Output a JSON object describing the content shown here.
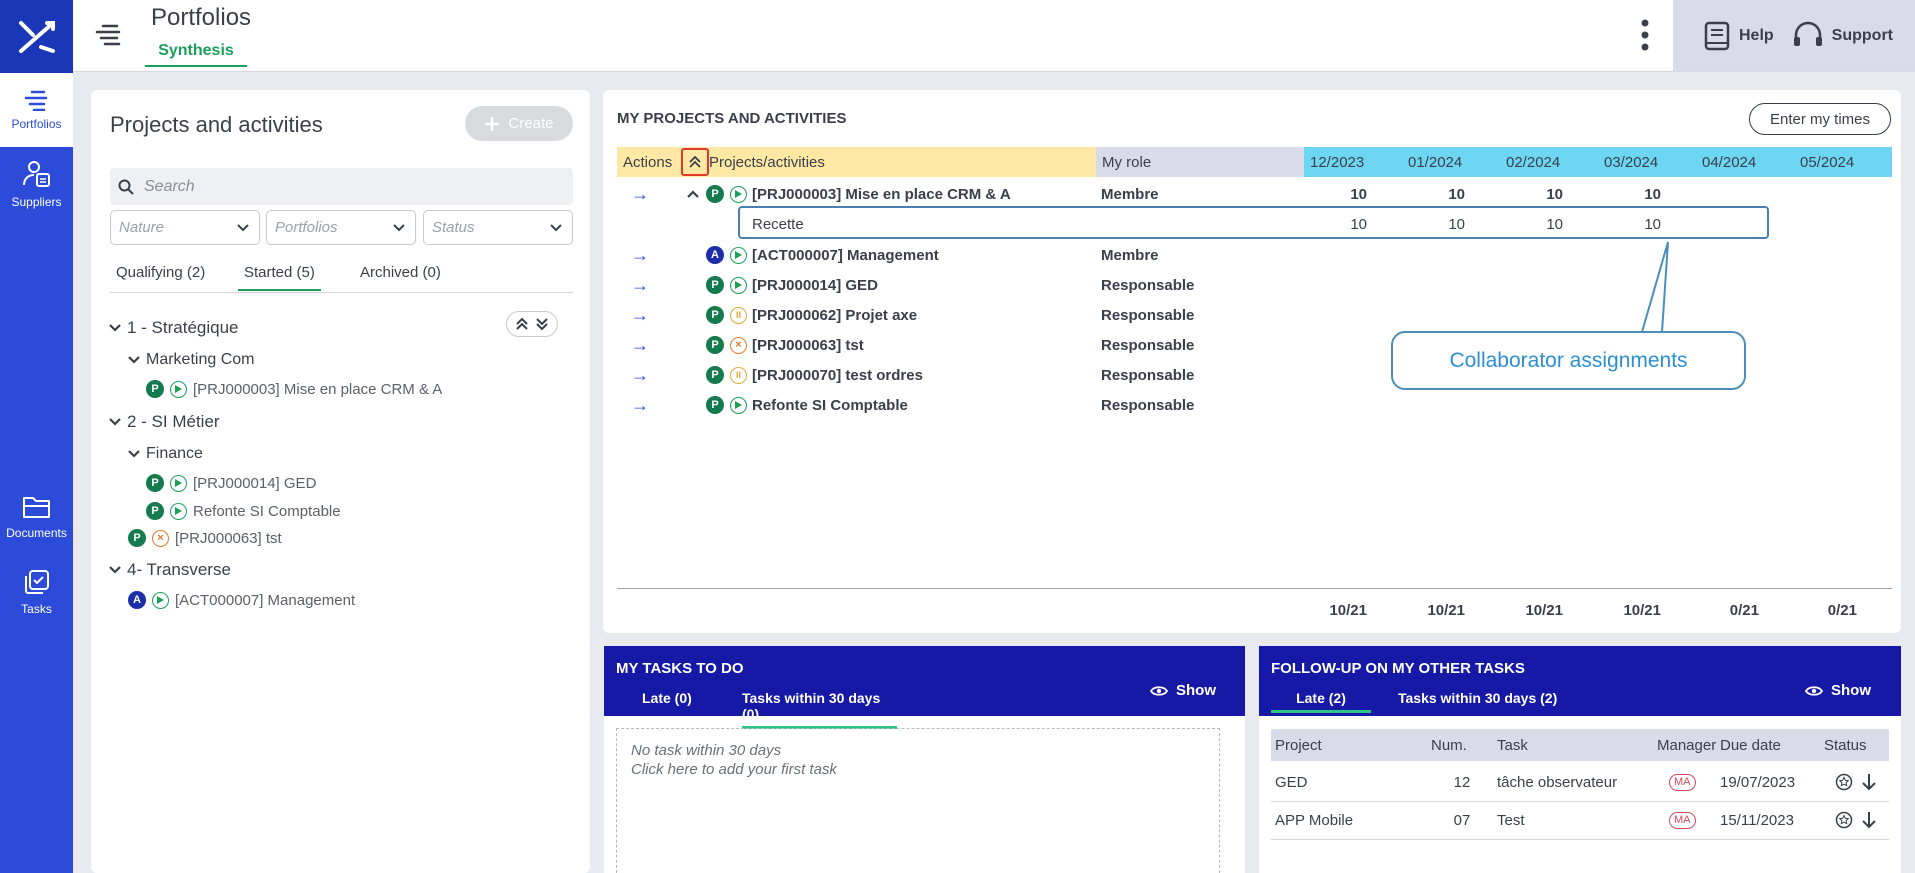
{
  "app": {
    "title": "Portfolios",
    "subtab": "Synthesis"
  },
  "sidebar": {
    "items": [
      {
        "label": "Portfolios"
      },
      {
        "label": "Suppliers"
      },
      {
        "label": "Documents"
      },
      {
        "label": "Tasks"
      }
    ]
  },
  "header": {
    "help": "Help",
    "support": "Support"
  },
  "left": {
    "title": "Projects and activities",
    "create": "Create",
    "search_placeholder": "Search",
    "filters": [
      "Nature",
      "Portfolios",
      "Status"
    ],
    "tabs": [
      "Qualifying (2)",
      "Started (5)",
      "Archived (0)"
    ],
    "tree": [
      {
        "label": "1 - Stratégique"
      },
      {
        "label": "Marketing Com"
      },
      {
        "label": "[PRJ000003] Mise en place CRM & A"
      },
      {
        "label": "2 - SI Métier"
      },
      {
        "label": "Finance"
      },
      {
        "label": "[PRJ000014] GED"
      },
      {
        "label": "Refonte SI Comptable"
      },
      {
        "label": "[PRJ000063] tst"
      },
      {
        "label": "4- Transverse"
      },
      {
        "label": "[ACT000007] Management"
      }
    ]
  },
  "main": {
    "title": "MY PROJECTS AND ACTIVITIES",
    "enter_times": "Enter my times",
    "headers": {
      "actions": "Actions",
      "projects": "Projects/activities",
      "role": "My role",
      "months": [
        "12/2023",
        "01/2024",
        "02/2024",
        "03/2024",
        "04/2024",
        "05/2024"
      ]
    },
    "rows": [
      {
        "badge": "P",
        "name": "[PRJ000003] Mise en place CRM & A",
        "role": "Membre",
        "values": [
          "10",
          "10",
          "10",
          "10",
          "",
          ""
        ]
      },
      {
        "badge": "",
        "name": "Recette",
        "role": "",
        "values": [
          "10",
          "10",
          "10",
          "10",
          "",
          ""
        ]
      },
      {
        "badge": "A",
        "name": "[ACT000007] Management",
        "role": "Membre",
        "values": [
          "",
          "",
          "",
          "",
          "",
          ""
        ]
      },
      {
        "badge": "P",
        "name": "[PRJ000014] GED",
        "role": "Responsable",
        "values": [
          "",
          "",
          "",
          "",
          "",
          ""
        ]
      },
      {
        "badge": "P",
        "name": "[PRJ000062] Projet axe",
        "role": "Responsable",
        "values": [
          "",
          "",
          "",
          "",
          "",
          ""
        ]
      },
      {
        "badge": "P",
        "name": "[PRJ000063] tst",
        "role": "Responsable",
        "values": [
          "",
          "",
          "",
          "",
          "",
          ""
        ]
      },
      {
        "badge": "P",
        "name": "[PRJ000070] test ordres",
        "role": "Responsable",
        "values": [
          "",
          "",
          "",
          "",
          "",
          ""
        ]
      },
      {
        "badge": "P",
        "name": "Refonte SI Comptable",
        "role": "Responsable",
        "values": [
          "",
          "",
          "",
          "",
          "",
          ""
        ]
      }
    ],
    "totals": [
      "10/21",
      "10/21",
      "10/21",
      "10/21",
      "0/21",
      "0/21"
    ],
    "callout": "Collaborator assignments"
  },
  "tasks": {
    "title": "MY TASKS TO DO",
    "tabs": [
      "Late (0)",
      "Tasks within 30 days (0)"
    ],
    "show": "Show",
    "empty1": "No task within 30 days",
    "empty2": "Click here to add your first task"
  },
  "followup": {
    "title": "FOLLOW-UP ON MY OTHER TASKS",
    "tabs": [
      "Late (2)",
      "Tasks within 30 days (2)"
    ],
    "show": "Show",
    "columns": [
      "Project",
      "Num.",
      "Task",
      "Manager",
      "Due date",
      "Status"
    ],
    "rows": [
      {
        "project": "GED",
        "num": "12",
        "task": "tâche observateur",
        "manager": "MA",
        "due": "19/07/2023"
      },
      {
        "project": "APP Mobile",
        "num": "07",
        "task": "Test",
        "manager": "MA",
        "due": "15/11/2023"
      }
    ]
  },
  "colors": {
    "sidebar": "#2b4bd8",
    "accent_green": "#1aa05a",
    "header_yellow": "#fde9a4",
    "header_cyan": "#6dd6f3",
    "task_header": "#1519a6"
  }
}
